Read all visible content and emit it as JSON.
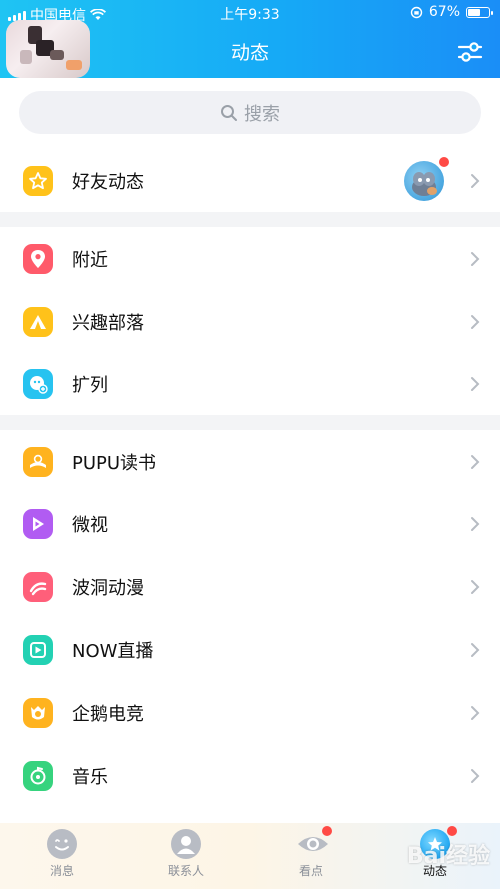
{
  "status_bar": {
    "carrier": "中国电信",
    "time": "上午9:33",
    "battery": "67%",
    "battery_level": 0.67
  },
  "header": {
    "title": "动态"
  },
  "search": {
    "placeholder": "搜索"
  },
  "sections": [
    {
      "items": [
        {
          "label": "好友动态",
          "icon": "star-icon",
          "color": "#ffc21a",
          "has_badge": true
        }
      ]
    },
    {
      "items": [
        {
          "label": "附近",
          "icon": "location-pin-icon",
          "color": "#ff5a6a"
        },
        {
          "label": "兴趣部落",
          "icon": "tent-icon",
          "color": "#ffc21a"
        },
        {
          "label": "扩列",
          "icon": "face-plus-icon",
          "color": "#27c3f0"
        }
      ]
    },
    {
      "items": [
        {
          "label": "PUPU读书",
          "icon": "book-icon",
          "color": "#ffb31f"
        },
        {
          "label": "微视",
          "icon": "play-icon",
          "color": "#b15cf2"
        },
        {
          "label": "波洞动漫",
          "icon": "wave-icon",
          "color": "#ff5f7a"
        },
        {
          "label": "NOW直播",
          "icon": "live-icon",
          "color": "#23d1b3"
        },
        {
          "label": "企鹅电竞",
          "icon": "penguin-badge-icon",
          "color": "#ffb31f"
        },
        {
          "label": "音乐",
          "icon": "music-icon",
          "color": "#36d37e"
        }
      ]
    }
  ],
  "tabbar": {
    "tabs": [
      {
        "label": "消息",
        "icon": "message-icon",
        "badge": false
      },
      {
        "label": "联系人",
        "icon": "contacts-icon",
        "badge": false
      },
      {
        "label": "看点",
        "icon": "eye-icon",
        "badge": true
      },
      {
        "label": "动态",
        "icon": "star-planet-icon",
        "badge": true,
        "active": true
      }
    ]
  },
  "watermark": "Bai经验"
}
